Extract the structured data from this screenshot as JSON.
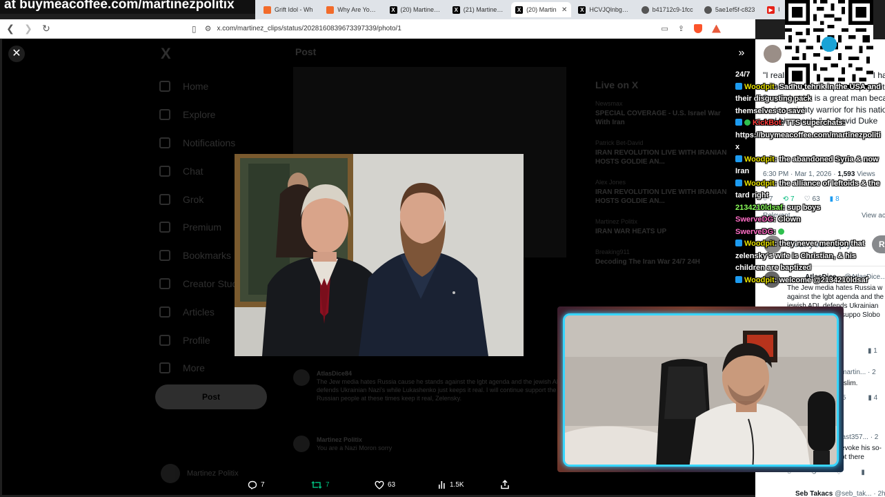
{
  "banner": {
    "text": "at buymeacoffee.com/martinezpolitix"
  },
  "tabs": [
    {
      "label": "Grift Idol - Wh",
      "favicon": "orange-square-icon",
      "active": false
    },
    {
      "label": "Why Are You A",
      "favicon": "orange-square-icon",
      "active": false
    },
    {
      "label": "(20) Martinez P",
      "favicon": "x-logo-icon",
      "active": false
    },
    {
      "label": "(21) Martinez P",
      "favicon": "x-logo-icon",
      "active": false
    },
    {
      "label": "(20) Martin",
      "favicon": "x-logo-icon",
      "active": true
    },
    {
      "label": "HCVJQlnbgAE\\",
      "favicon": "x-logo-icon",
      "active": false
    },
    {
      "label": "b41712c9-1fcc",
      "favicon": "globe-icon",
      "active": false
    },
    {
      "label": "5ae1ef5f-c823",
      "favicon": "globe-icon",
      "active": false
    },
    {
      "label": "U",
      "favicon": "youtube-icon",
      "active": false
    }
  ],
  "address": {
    "url": "x.com/martinez_clips/status/2028160839673397339/photo/1"
  },
  "left_page": {
    "logo": "X",
    "header": "Post",
    "nav": [
      "Home",
      "Explore",
      "Notifications",
      "Chat",
      "Grok",
      "Premium",
      "Bookmarks",
      "Creator Studio",
      "Articles",
      "Profile",
      "More"
    ],
    "post_button": "Post",
    "profile_name": "Martinez Politix",
    "trends_title": "Live on X",
    "trends": [
      {
        "source": "Newsmax",
        "headline": "SPECIAL COVERAGE - U.S. Israel War With Iran"
      },
      {
        "source": "Patrick Bet-David",
        "headline": "IRAN REVOLUTION LIVE WITH IRANIAN HOSTS GOLDIE AN..."
      },
      {
        "source": "Alex Jones",
        "headline": "IRAN REVOLUTION LIVE WITH IRANIAN HOSTS GOLDIE AN..."
      },
      {
        "source": "Martinez Politix",
        "headline": "IRAN WAR HEATS UP"
      },
      {
        "source": "Breaking911",
        "headline": "Decoding The Iran War 24/7 24H"
      }
    ],
    "replies": [
      {
        "name": "AtlasDice84",
        "text": "The Jew media hates Russia cause he stands against the lgbt agenda and the jewish ADL defends Ukrainian Nazi's while Lukashenko just keeps it real. I will continue support the Russian people at these times keep it real, Zelensky."
      },
      {
        "name": "Martinez Politix",
        "text": "You are a Nazi Moron sorry"
      }
    ]
  },
  "actions": {
    "replies": "7",
    "reposts": "7",
    "likes": "63",
    "views": "1.5K"
  },
  "right_panel": {
    "quote": "\"I realize that on some issues I have some difference in philosophy with Dugin, but he is a great man because he is a mighty warrior for his nation and his people.\" — David Duke",
    "meta_time": "6:30 PM · Mar 1, 2026 · ",
    "meta_views": "1,593",
    "meta_views_label": " Views",
    "stats": {
      "replies": "7",
      "reposts": "7",
      "likes": "63",
      "bookmarks": "8"
    },
    "relevant": "Relevant",
    "view_activity": "View ac",
    "reply_placeholder": "Post your reply",
    "reply_button": "R",
    "reply1_name": "AtlasDice...",
    "reply1_handle": "@AtlasDice... · 4",
    "reply1_text": "The Jew media hates Russia w against the lgbt agenda and the jewish ADL defends Ukrainian Nazi's. I will keep suppo Slobo homo N sky.",
    "reply1_stats": {
      "views": "1"
    },
    "reply2_handle": "@martin... · 2",
    "reply2_text": "Muslim.",
    "reply2_stats": {
      "likes": "5",
      "views": "4"
    },
    "reply3_handle": "east357... · 2",
    "reply3_text": "evoke his so- ot there",
    "reply4_name": "Seb Takacs",
    "reply4_handle": "@seb_tak... · 2h"
  },
  "chat": [
    {
      "user": "",
      "text": "24/7",
      "badge": "none",
      "color": "white"
    },
    {
      "user": "Woodpit",
      "text": ": Sadhu tehrik in the USA and their disgusting pack",
      "badge": "twitter",
      "color": "yellow"
    },
    {
      "user": "",
      "text": "themselves to save",
      "badge": "none",
      "color": "white"
    },
    {
      "user": "KickBot",
      "text": ": TTS superchats:",
      "badge": "twitter-mod",
      "color": "red"
    },
    {
      "user": "",
      "text": "https://buymeacoffee.com/martinezpoliti",
      "badge": "none",
      "color": "white"
    },
    {
      "user": "",
      "text": "x",
      "badge": "none",
      "color": "white"
    },
    {
      "user": "Woodpit",
      "text": ": the abandoned Syria & now",
      "badge": "twitter",
      "color": "yellow"
    },
    {
      "user": "",
      "text": "Iran",
      "badge": "none",
      "color": "white"
    },
    {
      "user": "Woodpit",
      "text": ": the alliance of leftoids & the",
      "badge": "twitter",
      "color": "yellow"
    },
    {
      "user": "",
      "text": "tard right",
      "badge": "none",
      "color": "white"
    },
    {
      "user": "2134210ldsaf",
      "text": ": sup boys",
      "badge": "none",
      "color": "lime"
    },
    {
      "user": "SwerveDG",
      "text": ": Clown",
      "badge": "none",
      "color": "pink"
    },
    {
      "user": "SwerveDG",
      "text": ":",
      "badge": "none",
      "color": "pink"
    },
    {
      "user": "Woodpit",
      "text": ": they never mention that",
      "badge": "twitter",
      "color": "yellow"
    },
    {
      "user": "",
      "text": "zelensky's wife is Christian, & his",
      "badge": "none",
      "color": "white"
    },
    {
      "user": "",
      "text": "children are baptized",
      "badge": "none",
      "color": "white"
    },
    {
      "user": "Woodpit",
      "text": ": welcome @2134210ldsaf",
      "badge": "twitter",
      "color": "yellow"
    }
  ],
  "colors": {
    "accent_blue": "#1d9bf0",
    "repost_green": "#00ba7c",
    "webcam_border": "#38d6ff",
    "chat_user_yellow": "#e6e000"
  }
}
